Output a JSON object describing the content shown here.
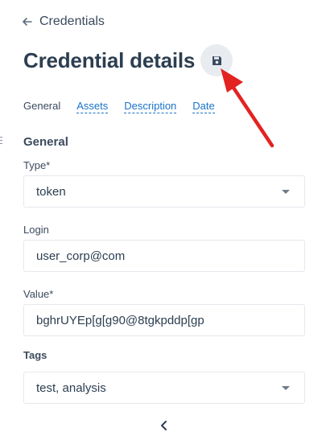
{
  "header": {
    "back_label": "Credentials",
    "title": "Credential details"
  },
  "tabs": [
    "General",
    "Assets",
    "Description",
    "Date"
  ],
  "section": {
    "title": "General"
  },
  "fields": {
    "type": {
      "label": "Type*",
      "value": "token"
    },
    "login": {
      "label": "Login",
      "value": "user_corp@com"
    },
    "value": {
      "label": "Value*",
      "value": "bghrUYEp[g[g90@8tgkpddp[gp"
    },
    "tags": {
      "label": "Tags",
      "value": "test, analysis"
    }
  },
  "icons": {
    "back": "arrow-left-icon",
    "save": "floppy-disk-icon",
    "collapse": "chevron-left-icon",
    "annotation": "red-pointer-arrow"
  },
  "colors": {
    "link": "#1a73c9",
    "save_button_bg": "#e8ecf1",
    "annotation_arrow": "#e32222"
  }
}
